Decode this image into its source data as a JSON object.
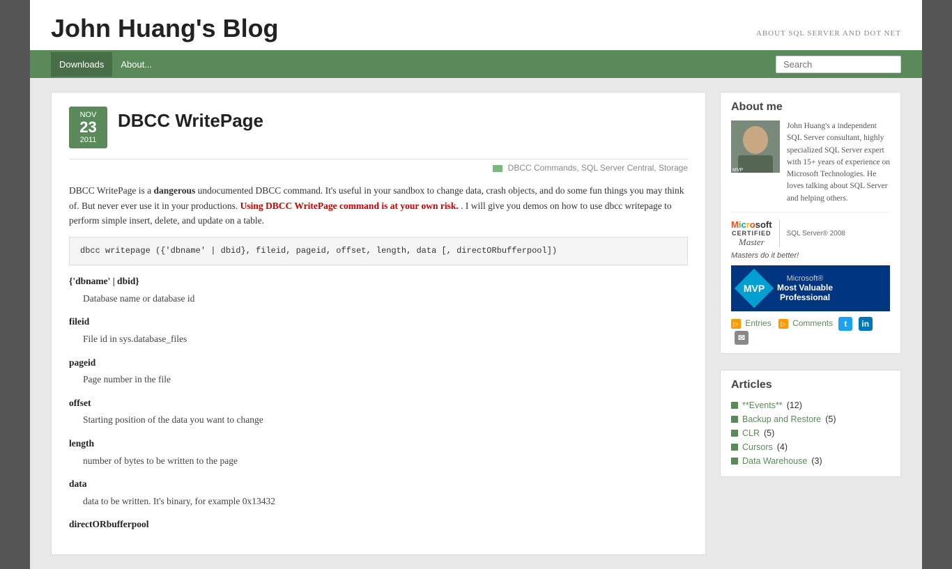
{
  "site": {
    "title": "John Huang's Blog",
    "tagline": "ABOUT SQL SERVER AND DOT NET"
  },
  "nav": {
    "links": [
      {
        "label": "Downloads",
        "active": true
      },
      {
        "label": "About...",
        "active": false
      }
    ],
    "search_placeholder": "Search"
  },
  "post": {
    "date": {
      "month": "Nov",
      "day": "23",
      "year": "2011"
    },
    "title": "DBCC WritePage",
    "meta_icon": "tag-icon",
    "meta_links": "DBCC Commands, SQL Server Central, Storage",
    "intro": "DBCC WritePage is a ",
    "intro_bold": "dangerous",
    "intro_rest": " undocumented DBCC command. It's useful in your sandbox to change data, crash objects, and do some fun things you may think of. But never ever use it in your productions.",
    "warning": "Using DBCC WritePage command is at your own risk.",
    "intro_end": " . I will give you demos on how to use dbcc writepage to perform simple insert, delete, and update on a table.",
    "code": "dbcc writepage ({'dbname' | dbid}, fileid, pageid, offset, length, data [, directORbufferpool])",
    "params": [
      {
        "name": "{'dbname' | dbid}",
        "desc": "Database name or database id"
      },
      {
        "name": "fileid",
        "desc": "File id in sys.database_files"
      },
      {
        "name": "pageid",
        "desc": "Page number in the file"
      },
      {
        "name": "offset",
        "desc": "Starting position of the data you want to change"
      },
      {
        "name": "length",
        "desc": "number of bytes to be written to the page"
      },
      {
        "name": "data",
        "desc": "data to be written. It's binary, for example 0x13432"
      },
      {
        "name": "directORbufferpool",
        "desc": ""
      }
    ]
  },
  "sidebar": {
    "about_me": {
      "title": "About me",
      "description": "John Huang's a independent SQL Server consultant, highly specialized SQL Server expert with 15+ years of experience on Microsoft Technologies. He loves talking about SQL Server and helping others.",
      "photo_badge": "MVP",
      "cert_label": "CERTIFIED",
      "cert_sublabel": "Master",
      "cert_product": "SQL Server® 2008",
      "tagline": "Masters do it better!",
      "mvp_title": "MVP",
      "mvp_line1": "Microsoft®",
      "mvp_line2": "Most Valuable",
      "mvp_line3": "Professional"
    },
    "feeds": {
      "entries_label": "Entries",
      "comments_label": "Comments"
    },
    "articles": {
      "title": "Articles",
      "items": [
        {
          "label": "**Events**",
          "count": "(12)"
        },
        {
          "label": "Backup and Restore",
          "count": "(5)"
        },
        {
          "label": "CLR",
          "count": "(5)"
        },
        {
          "label": "Cursors",
          "count": "(4)"
        },
        {
          "label": "Data Warehouse",
          "count": "(3)"
        }
      ]
    }
  }
}
